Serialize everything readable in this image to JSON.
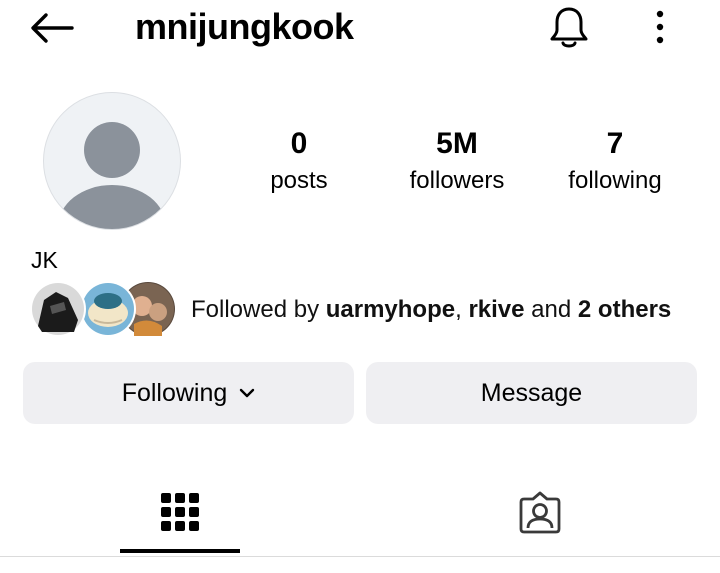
{
  "header": {
    "username": "mnijungkook",
    "back_icon": "arrow-left-icon",
    "notification_icon": "bell-icon",
    "more_icon": "vertical-dots-icon"
  },
  "profile": {
    "avatar": "default-avatar-icon",
    "display_name": "JK",
    "stats": [
      {
        "value": "0",
        "label": "posts"
      },
      {
        "value": "5M",
        "label": "followers"
      },
      {
        "value": "7",
        "label": "following"
      }
    ],
    "mutual": {
      "prefix": "Followed by ",
      "names": [
        "uarmyhope",
        "rkive"
      ],
      "separator": ", ",
      "conjunction": " and ",
      "others": "2 others"
    }
  },
  "actions": {
    "following_label": "Following",
    "message_label": "Message"
  },
  "tabs": [
    {
      "icon": "grid-icon",
      "active": true
    },
    {
      "icon": "tagged-user-icon",
      "active": false
    }
  ],
  "colors": {
    "button_bg": "#efeff2",
    "avatar_bg": "#eff2f5",
    "avatar_silhouette": "#8b929b"
  }
}
